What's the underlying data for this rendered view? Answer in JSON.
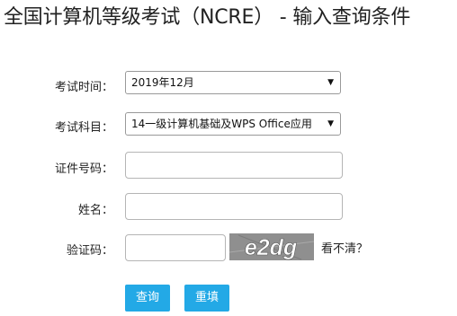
{
  "page": {
    "title": "全国计算机等级考试（NCRE） - 输入查询条件"
  },
  "form": {
    "exam_time": {
      "label": "考试时间：",
      "selected": "2019年12月"
    },
    "subject": {
      "label": "考试科目：",
      "selected": "14一级计算机基础及WPS Office应用"
    },
    "id_number": {
      "label": "证件号码：",
      "value": ""
    },
    "name": {
      "label": "姓名：",
      "value": ""
    },
    "captcha": {
      "label": "验证码：",
      "value": "",
      "image_text": "e2dg",
      "refresh_text": "看不清？"
    }
  },
  "buttons": {
    "query": "查询",
    "reset": "重填"
  },
  "colors": {
    "button_bg": "#23a9e6",
    "captcha_bg": "#8f8f8f"
  }
}
